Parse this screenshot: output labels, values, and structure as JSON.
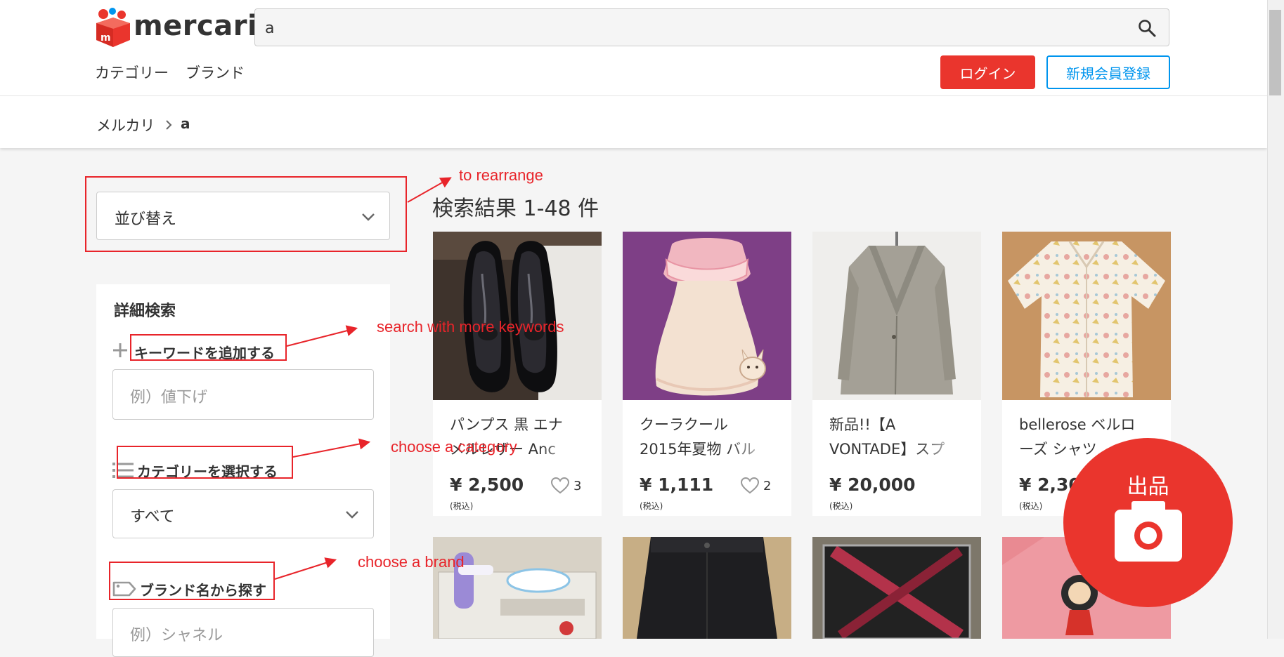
{
  "header": {
    "logo_text": "mercari",
    "search_value": "a",
    "nav": {
      "category": "カテゴリー",
      "brand": "ブランド"
    },
    "login_label": "ログイン",
    "signup_label": "新規会員登録"
  },
  "breadcrumb": {
    "home": "メルカリ",
    "current": "a"
  },
  "sidebar": {
    "sort_label": "並び替え",
    "detail_title": "詳細検索",
    "keyword_label": "キーワードを追加する",
    "keyword_placeholder": "例）値下げ",
    "category_label": "カテゴリーを選択する",
    "category_value": "すべて",
    "brand_label": "ブランド名から探す",
    "brand_placeholder": "例）シャネル"
  },
  "annotations": {
    "sort": "to rearrange",
    "keyword": "search with more keywords",
    "category": "choose a category",
    "brand": "choose a brand"
  },
  "results": {
    "heading": "検索結果 1-48 件",
    "items": [
      {
        "name_line1": "パンプス 黒 エナ",
        "name_line2": "メルレザー Anc",
        "price": "¥ 2,500",
        "tax": "(税込)",
        "likes": "3"
      },
      {
        "name_line1": "クーラクール",
        "name_line2": "2015年夏物 バル",
        "price": "¥ 1,111",
        "tax": "(税込)",
        "likes": "2"
      },
      {
        "name_line1": "新品!!【A",
        "name_line2": "VONTADE】スプ",
        "price": "¥ 20,000",
        "tax": "(税込)",
        "likes": ""
      },
      {
        "name_line1": "bellerose ベルロ",
        "name_line2": "ーズ シャツ",
        "price": "¥ 2,30",
        "tax": "(税込)",
        "likes": ""
      }
    ]
  },
  "sell_button": {
    "label": "出品"
  },
  "colors": {
    "brand_red": "#ea352d",
    "signup_blue": "#0095ee",
    "annotation_red": "#e8242a"
  }
}
